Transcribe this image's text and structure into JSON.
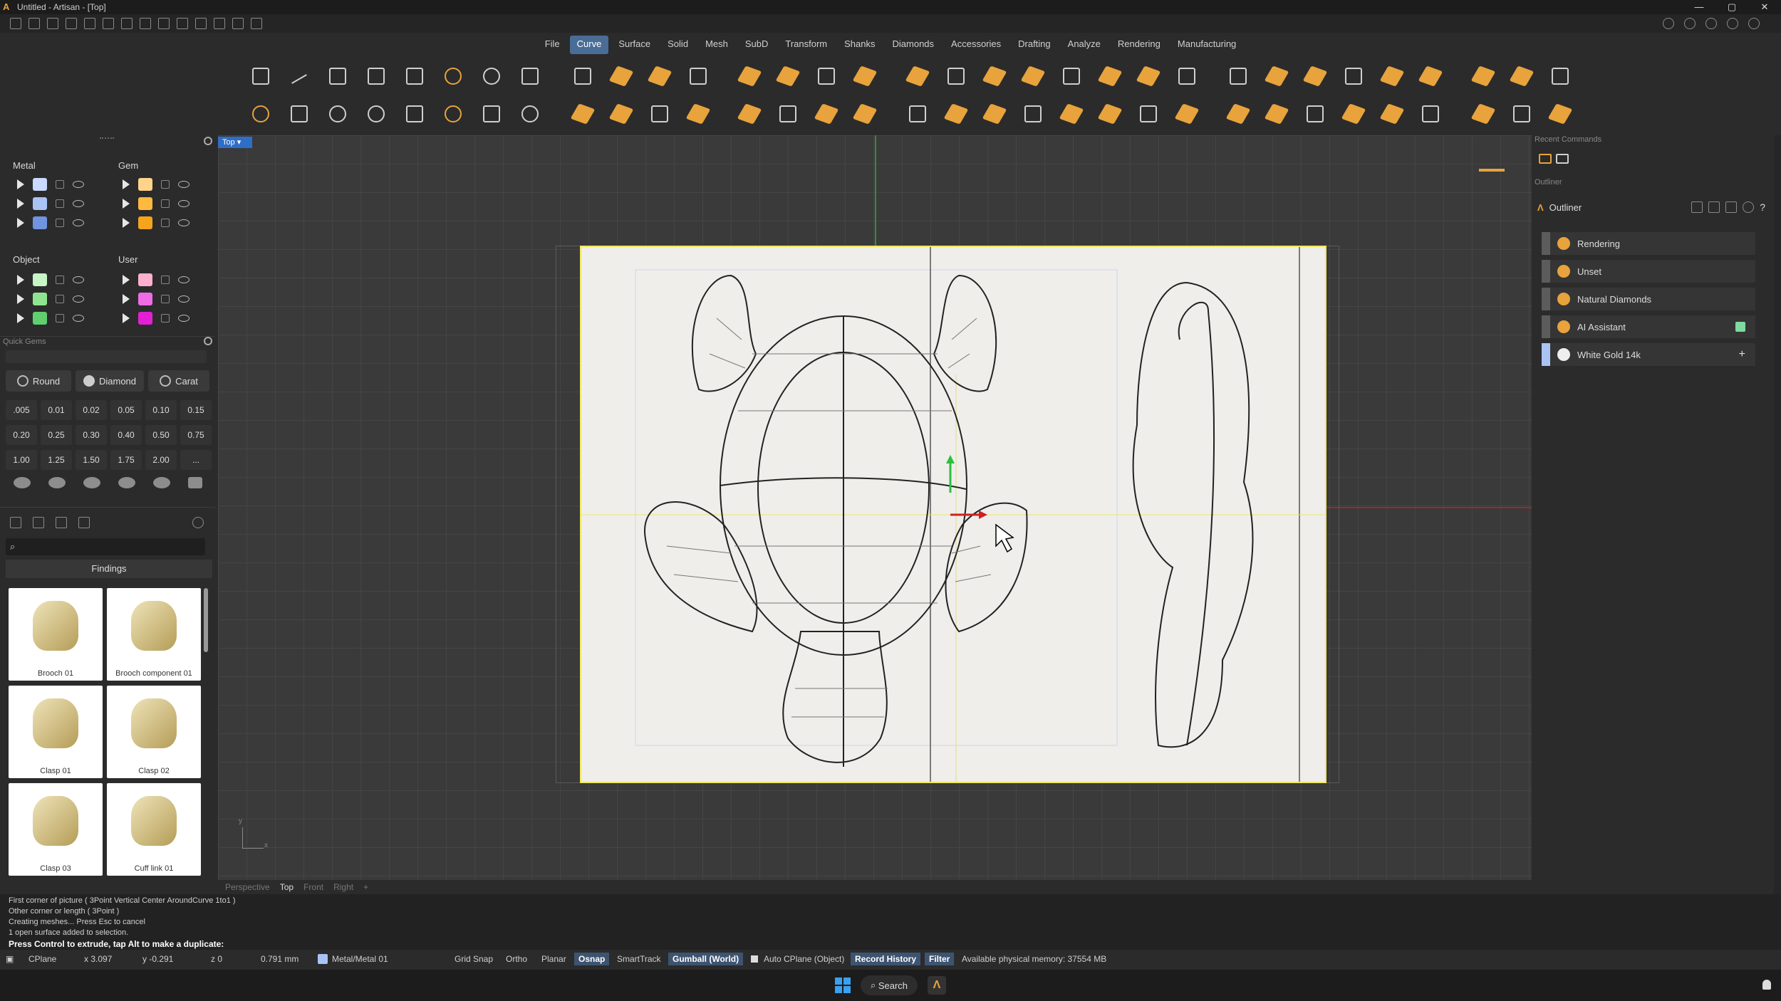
{
  "titlebar": {
    "title": "Untitled - Artisan - [Top]",
    "min": "—",
    "max": "▢",
    "close": "✕"
  },
  "menu": [
    "File",
    "Curve",
    "Surface",
    "Solid",
    "Mesh",
    "SubD",
    "Transform",
    "Shanks",
    "Diamonds",
    "Accessories",
    "Drafting",
    "Analyze",
    "Rendering",
    "Manufacturing"
  ],
  "menu_active": "Curve",
  "layers": {
    "metal": {
      "title": "Metal",
      "colors": [
        "#c9d9ff",
        "#a9c3f5",
        "#6f94e0"
      ]
    },
    "gem": {
      "title": "Gem",
      "colors": [
        "#ffd48a",
        "#ffb93f",
        "#f5a41c"
      ]
    },
    "object": {
      "title": "Object",
      "colors": [
        "#c6f5c6",
        "#8fe58f",
        "#5fcf6f"
      ]
    },
    "user": {
      "title": "User",
      "colors": [
        "#ffb0cc",
        "#f06ce6",
        "#e51fd4"
      ]
    }
  },
  "quick_gems": {
    "title": "Quick Gems",
    "buttons": [
      "Round",
      "Diamond",
      "Carat"
    ],
    "sizes": [
      ".005",
      "0.01",
      "0.02",
      "0.05",
      "0.10",
      "0.15",
      "0.20",
      "0.25",
      "0.30",
      "0.40",
      "0.50",
      "0.75",
      "1.00",
      "1.25",
      "1.50",
      "1.75",
      "2.00",
      "..."
    ]
  },
  "library": {
    "search_placeholder": "",
    "category": "Findings",
    "items": [
      "Brooch 01",
      "Brooch component 01",
      "Clasp 01",
      "Clasp 02",
      "Clasp 03",
      "Cuff link 01"
    ]
  },
  "viewport": {
    "tag": "Top",
    "tabs": [
      "Perspective",
      "Top",
      "Front",
      "Right",
      "+"
    ],
    "active_tab": "Top",
    "axis_x": "x",
    "axis_y": "y"
  },
  "right": {
    "recent_commands": "Recent Commands",
    "outliner_header": "Outliner",
    "outliner_tab": "Outliner",
    "rows": [
      "Rendering",
      "Unset",
      "Natural Diamonds",
      "AI Assistant",
      "White Gold 14k"
    ]
  },
  "cmdlog": [
    "First corner of picture ( 3Point  Vertical  Center  AroundCurve  1to1 )",
    "Other corner or length ( 3Point )",
    "Creating meshes... Press Esc to cancel",
    "1 open surface added to selection."
  ],
  "prompt": "Press Control to extrude, tap Alt to make a duplicate:",
  "status": {
    "cplane": "CPlane",
    "x": "x 3.097",
    "y": "y -0.291",
    "z": "z 0",
    "units": "0.791 mm",
    "layer": "Metal/Metal 01",
    "grid_snap": "Grid Snap",
    "ortho": "Ortho",
    "planar": "Planar",
    "osnap": "Osnap",
    "smarttrack": "SmartTrack",
    "gumball": "Gumball (World)",
    "auto_cplane": "Auto CPlane (Object)",
    "record_history": "Record History",
    "filter": "Filter",
    "memory": "Available physical memory: 37554 MB"
  },
  "taskbar": {
    "search": "Search"
  }
}
